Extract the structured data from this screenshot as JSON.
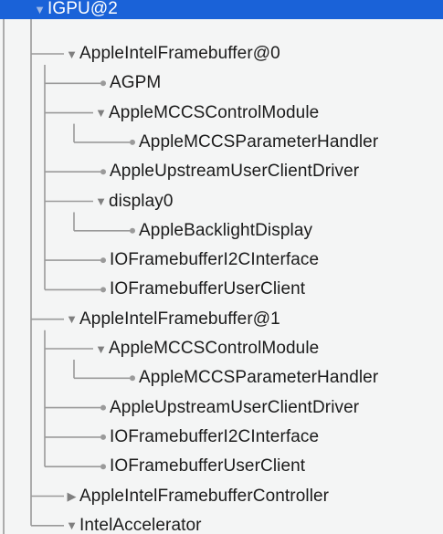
{
  "colors": {
    "selection": "#1a62d8",
    "tree_line": "#9a9a9a",
    "text": "#1b1b1b",
    "selected_text": "#ffffff",
    "disclosure": "#7f7f7f"
  },
  "tree": [
    {
      "label": "IGPU@2",
      "depth": 0,
      "expandable": true,
      "expanded": true,
      "selected": true
    },
    {
      "label": "AppleIntelFramebuffer@0",
      "depth": 1,
      "expandable": true,
      "expanded": true
    },
    {
      "label": "AGPM",
      "depth": 2,
      "expandable": false
    },
    {
      "label": "AppleMCCSControlModule",
      "depth": 2,
      "expandable": true,
      "expanded": true
    },
    {
      "label": "AppleMCCSParameterHandler",
      "depth": 3,
      "expandable": false
    },
    {
      "label": "AppleUpstreamUserClientDriver",
      "depth": 2,
      "expandable": false
    },
    {
      "label": "display0",
      "depth": 2,
      "expandable": true,
      "expanded": true
    },
    {
      "label": "AppleBacklightDisplay",
      "depth": 3,
      "expandable": false
    },
    {
      "label": "IOFramebufferI2CInterface",
      "depth": 2,
      "expandable": false
    },
    {
      "label": "IOFramebufferUserClient",
      "depth": 2,
      "expandable": false
    },
    {
      "label": "AppleIntelFramebuffer@1",
      "depth": 1,
      "expandable": true,
      "expanded": true
    },
    {
      "label": "AppleMCCSControlModule",
      "depth": 2,
      "expandable": true,
      "expanded": true
    },
    {
      "label": "AppleMCCSParameterHandler",
      "depth": 3,
      "expandable": false
    },
    {
      "label": "AppleUpstreamUserClientDriver",
      "depth": 2,
      "expandable": false
    },
    {
      "label": "IOFramebufferI2CInterface",
      "depth": 2,
      "expandable": false
    },
    {
      "label": "IOFramebufferUserClient",
      "depth": 2,
      "expandable": false
    },
    {
      "label": "AppleIntelFramebufferController",
      "depth": 1,
      "expandable": true,
      "expanded": false
    },
    {
      "label": "IntelAccelerator",
      "depth": 1,
      "expandable": true,
      "expanded": true
    }
  ],
  "icons": {
    "expanded": "triangle-down-icon",
    "collapsed": "triangle-right-icon",
    "leaf": "leaf-dot-icon"
  }
}
